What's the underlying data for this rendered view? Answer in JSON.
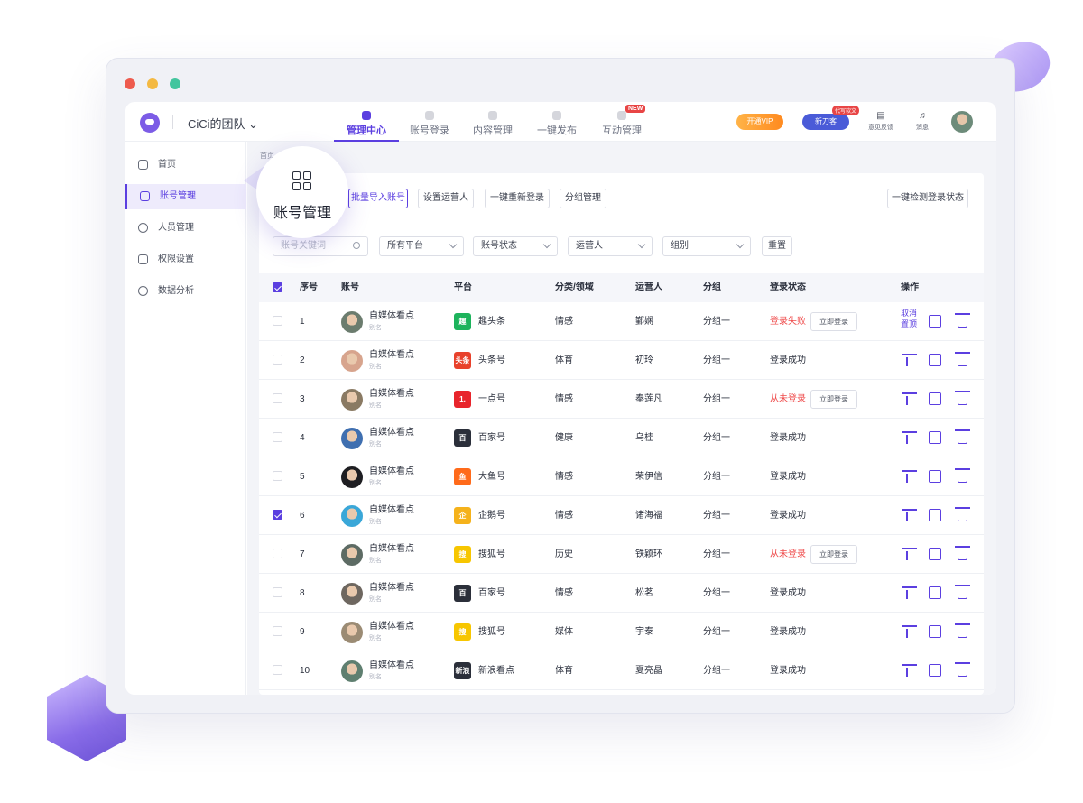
{
  "app": {
    "team_name": "CiCi的团队 ⌄"
  },
  "nav": [
    {
      "label": "管理中心",
      "active": true
    },
    {
      "label": "账号登录",
      "active": false
    },
    {
      "label": "内容管理",
      "active": false
    },
    {
      "label": "一键发布",
      "active": false
    },
    {
      "label": "互动管理",
      "active": false,
      "badge": "NEW"
    }
  ],
  "header": {
    "vip_label": "开通VIP",
    "ai_label": "新刀客",
    "ai_badge": "代写软文",
    "feedback_label": "意见反馈",
    "message_label": "消息"
  },
  "sidebar": [
    {
      "label": "首页",
      "icon": "home-icon"
    },
    {
      "label": "账号管理",
      "icon": "grid-icon",
      "active": true
    },
    {
      "label": "人员管理",
      "icon": "user-icon"
    },
    {
      "label": "权限设置",
      "icon": "lock-icon"
    },
    {
      "label": "数据分析",
      "icon": "chart-pie-icon"
    }
  ],
  "breadcrumb": "首页",
  "callout": {
    "label": "账号管理"
  },
  "toolbar": {
    "batch_import": "批量导入账号",
    "set_operator": "设置运营人",
    "relogin_all": "一键重新登录",
    "group_manage": "分组管理",
    "check_status": "一键检测登录状态"
  },
  "filters": {
    "keyword_placeholder": "账号关键词",
    "platform": "所有平台",
    "status": "账号状态",
    "operator": "运营人",
    "group": "组别",
    "reset": "重置"
  },
  "table": {
    "headers": [
      "序号",
      "账号",
      "平台",
      "分类/领域",
      "运营人",
      "分组",
      "登录状态",
      "操作"
    ],
    "relogin_label": "立即登录",
    "unpin_label": "取消置顶",
    "rows": [
      {
        "no": "1",
        "account": "自媒体看点",
        "alias": "别名",
        "platform": "趣头条",
        "logo": "趣",
        "logo_color": "#1db35c",
        "category": "情感",
        "operator": "鄞娴",
        "group": "分组一",
        "status": "登录失败",
        "status_fail": true,
        "pinned": true,
        "checked": false,
        "avatar": "#6b7c6e"
      },
      {
        "no": "2",
        "account": "自媒体看点",
        "alias": "别名",
        "platform": "头条号",
        "logo": "头条",
        "logo_color": "#e8412b",
        "category": "体育",
        "operator": "初玲",
        "group": "分组一",
        "status": "登录成功",
        "status_fail": false,
        "pinned": false,
        "checked": false,
        "avatar": "#d7a48d"
      },
      {
        "no": "3",
        "account": "自媒体看点",
        "alias": "别名",
        "platform": "一点号",
        "logo": "1.",
        "logo_color": "#e8252c",
        "category": "情感",
        "operator": "奉莲凡",
        "group": "分组一",
        "status": "从未登录",
        "status_fail": true,
        "pinned": false,
        "checked": false,
        "avatar": "#8a7a63"
      },
      {
        "no": "4",
        "account": "自媒体看点",
        "alias": "别名",
        "platform": "百家号",
        "logo": "百",
        "logo_color": "#2b2f3a",
        "category": "健康",
        "operator": "乌桂",
        "group": "分组一",
        "status": "登录成功",
        "status_fail": false,
        "pinned": false,
        "checked": false,
        "avatar": "#3f6fb0"
      },
      {
        "no": "5",
        "account": "自媒体看点",
        "alias": "别名",
        "platform": "大鱼号",
        "logo": "鱼",
        "logo_color": "#ff6a1a",
        "category": "情感",
        "operator": "荣伊信",
        "group": "分组一",
        "status": "登录成功",
        "status_fail": false,
        "pinned": false,
        "checked": false,
        "avatar": "#1e1e22"
      },
      {
        "no": "6",
        "account": "自媒体看点",
        "alias": "别名",
        "platform": "企鹅号",
        "logo": "企",
        "logo_color": "#f5b21b",
        "category": "情感",
        "operator": "诸海福",
        "group": "分组一",
        "status": "登录成功",
        "status_fail": false,
        "pinned": false,
        "checked": true,
        "avatar": "#3aa7d8"
      },
      {
        "no": "7",
        "account": "自媒体看点",
        "alias": "别名",
        "platform": "搜狐号",
        "logo": "搜",
        "logo_color": "#f7c600",
        "category": "历史",
        "operator": "铁颖环",
        "group": "分组一",
        "status": "从未登录",
        "status_fail": true,
        "pinned": false,
        "checked": false,
        "avatar": "#5d6b64"
      },
      {
        "no": "8",
        "account": "自媒体看点",
        "alias": "别名",
        "platform": "百家号",
        "logo": "百",
        "logo_color": "#2b2f3a",
        "category": "情感",
        "operator": "松茗",
        "group": "分组一",
        "status": "登录成功",
        "status_fail": false,
        "pinned": false,
        "checked": false,
        "avatar": "#6e6760"
      },
      {
        "no": "9",
        "account": "自媒体看点",
        "alias": "别名",
        "platform": "搜狐号",
        "logo": "搜",
        "logo_color": "#f7c600",
        "category": "媒体",
        "operator": "宇泰",
        "group": "分组一",
        "status": "登录成功",
        "status_fail": false,
        "pinned": false,
        "checked": false,
        "avatar": "#9b8b74"
      },
      {
        "no": "10",
        "account": "自媒体看点",
        "alias": "别名",
        "platform": "新浪看点",
        "logo": "新浪",
        "logo_color": "#2b2f3a",
        "category": "体育",
        "operator": "夏亮晶",
        "group": "分组一",
        "status": "登录成功",
        "status_fail": false,
        "pinned": false,
        "checked": false,
        "avatar": "#5f7f70"
      }
    ]
  },
  "colors": {
    "accent": "#5b3fe0",
    "fail": "#ef4b4b"
  }
}
